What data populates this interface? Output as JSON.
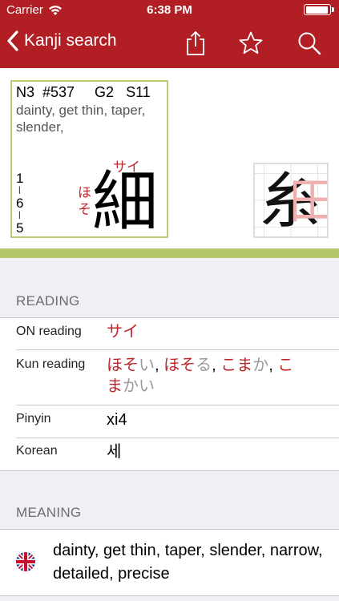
{
  "status": {
    "carrier": "Carrier",
    "time": "6:38 PM"
  },
  "nav": {
    "back_label": "Kanji search"
  },
  "card": {
    "meta": "N3  #537     G2   S11",
    "meaning_preview": "dainty, get thin, taper, slender,",
    "strokes": [
      "1",
      "6",
      "5"
    ],
    "on_ruby": "サイ",
    "kun_ruby": "ほそ",
    "kanji": "細",
    "stroke_left": "糸",
    "stroke_right": "田"
  },
  "reading": {
    "header": "READING",
    "on_label": "ON reading",
    "on_value": "サイ",
    "kun_label": "Kun reading",
    "kun_parts": [
      {
        "t": "ほそ",
        "c": "red"
      },
      {
        "t": "い",
        "c": "gray"
      },
      {
        "t": ", ",
        "c": "black"
      },
      {
        "t": "ほそ",
        "c": "red"
      },
      {
        "t": "る",
        "c": "gray"
      },
      {
        "t": ", ",
        "c": "black"
      },
      {
        "t": "こま",
        "c": "red"
      },
      {
        "t": "か",
        "c": "gray"
      },
      {
        "t": ", ",
        "c": "black"
      },
      {
        "t": "こまかい",
        "c": "red_gray"
      }
    ],
    "kun_line1_end": "こ",
    "kun_line2_red": "ま",
    "kun_line2_gray": "かい",
    "pinyin_label": "Pinyin",
    "pinyin_value": "xi4",
    "korean_label": "Korean",
    "korean_value": "세"
  },
  "meaning": {
    "header": "MEANING",
    "text": "dainty, get thin, taper, slender, narrow, detailed, precise"
  },
  "colors": {
    "accent": "#b11f25",
    "kana_red": "#c0272d",
    "card_border": "#b9cc72"
  }
}
